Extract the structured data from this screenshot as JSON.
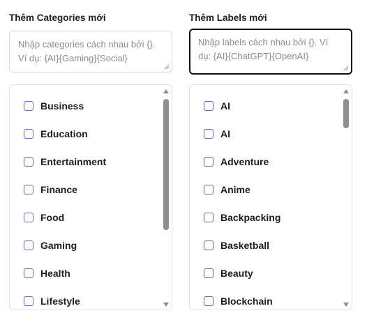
{
  "categories": {
    "heading": "Thêm Categories mới",
    "placeholder_line1": "Nhập categories cách nhau bởi {}.",
    "placeholder_line2": "Ví dụ: {AI}{Gaming}{Social}",
    "items": [
      "Business",
      "Education",
      "Entertainment",
      "Finance",
      "Food",
      "Gaming",
      "Health",
      "Lifestyle"
    ]
  },
  "labels": {
    "heading": "Thêm Labels mới",
    "placeholder_line1": "Nhập labels cách nhau bởi {}. Ví",
    "placeholder_line2": "dụ: {AI}{ChatGPT}{OpenAI}",
    "items": [
      "AI",
      "AI",
      "Adventure",
      "Anime",
      "Backpacking",
      "Basketball",
      "Beauty",
      "Blockchain"
    ]
  },
  "colors": {
    "checkbox_border": "#6c63c9",
    "scrollbar": "#8f8f8f",
    "focus_border": "#111111"
  },
  "icons": {
    "scroll_up": "triangle-up",
    "scroll_down": "triangle-down",
    "resize": "resize-grip"
  }
}
